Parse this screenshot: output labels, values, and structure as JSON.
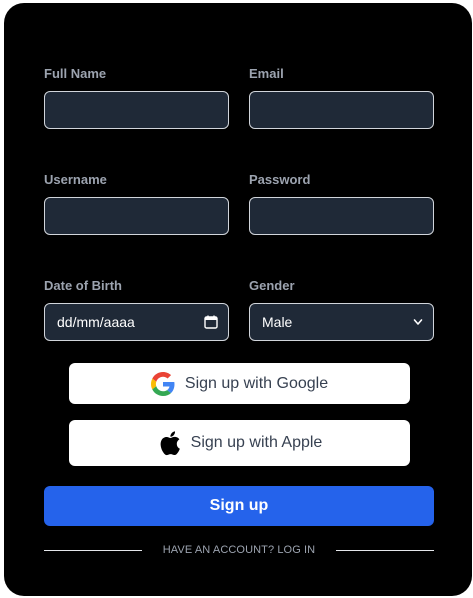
{
  "form": {
    "full_name": {
      "label": "Full Name",
      "value": ""
    },
    "email": {
      "label": "Email",
      "value": ""
    },
    "username": {
      "label": "Username",
      "value": ""
    },
    "password": {
      "label": "Password",
      "value": ""
    },
    "dob": {
      "label": "Date of Birth",
      "placeholder": "dd/mm/aaaa"
    },
    "gender": {
      "label": "Gender",
      "selected": "Male"
    }
  },
  "social": {
    "google_label": "Sign up with Google",
    "apple_label": "Sign up with Apple"
  },
  "actions": {
    "signup_label": "Sign up",
    "login_text": "HAVE AN ACCOUNT? LOG IN"
  },
  "colors": {
    "card_bg": "#000000",
    "input_bg": "#1f2937",
    "primary": "#2563eb",
    "label": "#9ca3af"
  },
  "icons": {
    "google": "google-g-icon",
    "apple": "apple-logo-icon",
    "calendar": "calendar-icon",
    "chevron": "chevron-down-icon"
  }
}
